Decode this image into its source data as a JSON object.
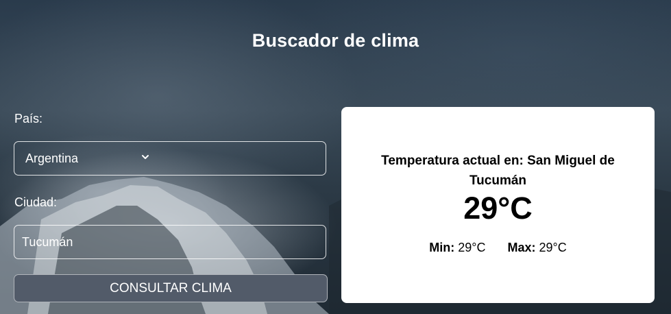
{
  "header": {
    "title": "Buscador de clima"
  },
  "form": {
    "country_label": "País:",
    "country_selected": "Argentina",
    "city_label": "Ciudad:",
    "city_value": "Tucumán",
    "submit_label": "CONSULTAR CLIMA"
  },
  "result": {
    "heading": "Temperatura actual en: San Miguel de Tucumán",
    "temperature": "29°C",
    "min_label": "Min:",
    "min_value": "29°C",
    "max_label": "Max:",
    "max_value": "29°C"
  },
  "icons": {
    "select_chevron": "chevron-down-icon"
  },
  "colors": {
    "button_bg": "#525b69",
    "card_bg": "#ffffff",
    "background_dark": "#24303c"
  }
}
